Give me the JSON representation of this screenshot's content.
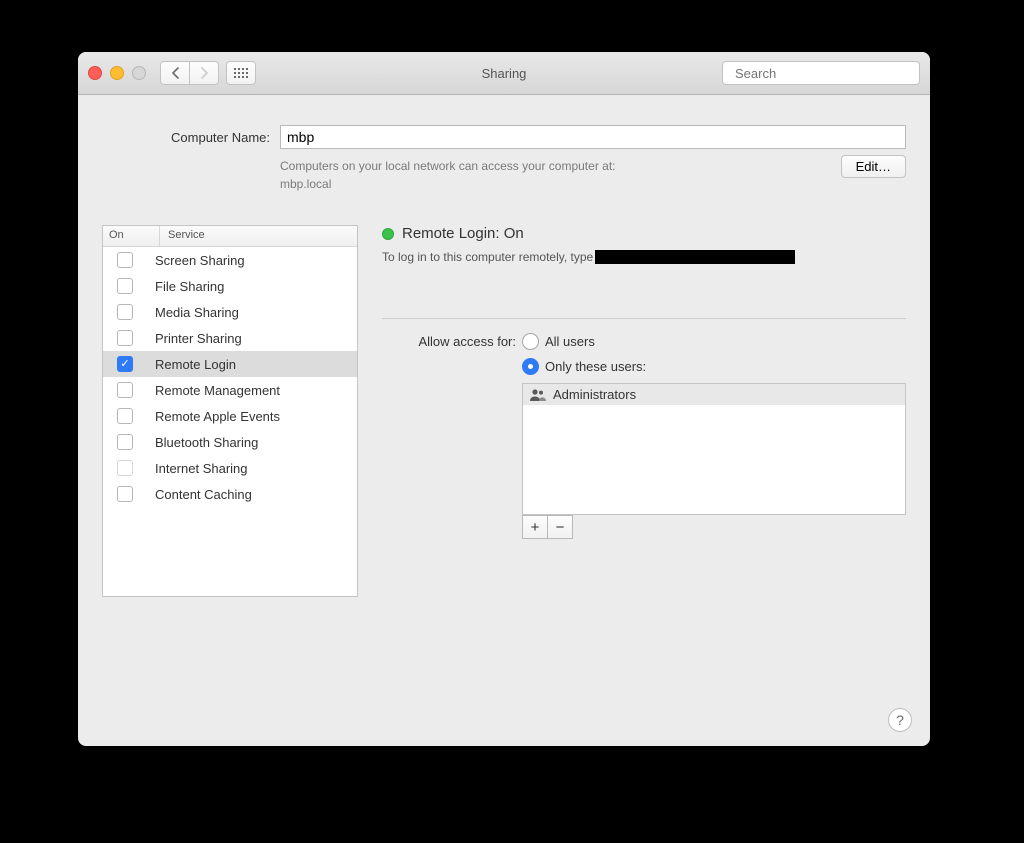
{
  "window": {
    "title": "Sharing"
  },
  "toolbar": {
    "search_placeholder": "Search"
  },
  "computer_name": {
    "label": "Computer Name:",
    "value": "mbp",
    "hint_line1": "Computers on your local network can access your computer at:",
    "hint_line2": "mbp.local",
    "edit_label": "Edit…"
  },
  "services": {
    "header_on": "On",
    "header_service": "Service",
    "items": [
      {
        "label": "Screen Sharing",
        "checked": false,
        "selected": false,
        "dim": false
      },
      {
        "label": "File Sharing",
        "checked": false,
        "selected": false,
        "dim": false
      },
      {
        "label": "Media Sharing",
        "checked": false,
        "selected": false,
        "dim": false
      },
      {
        "label": "Printer Sharing",
        "checked": false,
        "selected": false,
        "dim": false
      },
      {
        "label": "Remote Login",
        "checked": true,
        "selected": true,
        "dim": false
      },
      {
        "label": "Remote Management",
        "checked": false,
        "selected": false,
        "dim": false
      },
      {
        "label": "Remote Apple Events",
        "checked": false,
        "selected": false,
        "dim": false
      },
      {
        "label": "Bluetooth Sharing",
        "checked": false,
        "selected": false,
        "dim": false
      },
      {
        "label": "Internet Sharing",
        "checked": false,
        "selected": false,
        "dim": true
      },
      {
        "label": "Content Caching",
        "checked": false,
        "selected": false,
        "dim": false
      }
    ]
  },
  "detail": {
    "status_title": "Remote Login: On",
    "login_hint": "To log in to this computer remotely, type ",
    "access_label": "Allow access for:",
    "radio_all": "All users",
    "radio_these": "Only these users:",
    "selected_radio": "these",
    "users": [
      {
        "label": "Administrators"
      }
    ],
    "plus": "+",
    "minus": "−"
  },
  "help_label": "?"
}
